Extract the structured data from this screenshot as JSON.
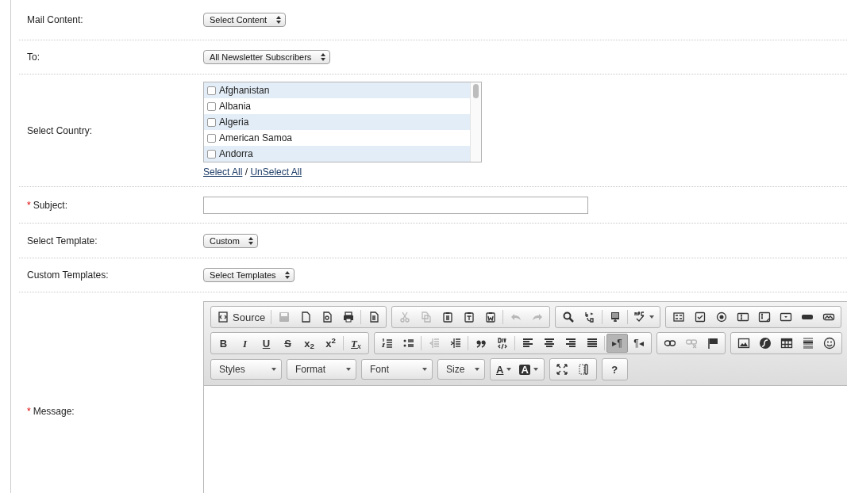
{
  "form": {
    "rows": [
      {
        "kind": "select",
        "label": "Mail Content:",
        "value": "Select Content"
      },
      {
        "kind": "select",
        "label": "To:",
        "value": "All Newsletter Subscribers"
      },
      {
        "kind": "checklist",
        "label": "Select Country:",
        "items": [
          {
            "text": "Afghanistan",
            "checked": false
          },
          {
            "text": "Albania",
            "checked": false
          },
          {
            "text": "Algeria",
            "checked": false
          },
          {
            "text": "American Samoa",
            "checked": false
          },
          {
            "text": "Andorra",
            "checked": false
          }
        ],
        "links": [
          "Select All",
          "UnSelect All"
        ],
        "link_separator": "/"
      },
      {
        "kind": "text",
        "label": "Subject:",
        "mark": "*"
      },
      {
        "kind": "select",
        "label": "Select Template:",
        "value": "Custom"
      },
      {
        "kind": "select",
        "label": "Custom Templates:",
        "value": "Select Templates"
      },
      {
        "kind": "editor",
        "label": "Message:",
        "mark": "*",
        "toolbar": [
          [
            {
              "buttons": [
                {
                  "kind": "text",
                  "label": "Source",
                  "disabled": false,
                  "on": false
                },
                {
                  "kind": "separator"
                },
                {
                  "kind": "icon",
                  "disabled": true,
                  "on": false
                },
                {
                  "kind": "icon",
                  "disabled": false,
                  "on": false
                },
                {
                  "kind": "icon",
                  "disabled": false,
                  "on": false
                },
                {
                  "kind": "icon",
                  "disabled": false,
                  "on": false
                },
                {
                  "kind": "separator"
                },
                {
                  "kind": "icon",
                  "disabled": false,
                  "on": false
                }
              ]
            },
            {
              "buttons": [
                {
                  "kind": "icon",
                  "disabled": true,
                  "on": false
                },
                {
                  "kind": "icon",
                  "disabled": true,
                  "on": false
                },
                {
                  "kind": "icon",
                  "disabled": false,
                  "on": false
                },
                {
                  "kind": "icon",
                  "disabled": false,
                  "on": false
                },
                {
                  "kind": "icon",
                  "disabled": false,
                  "on": false
                },
                {
                  "kind": "separator"
                },
                {
                  "kind": "icon",
                  "disabled": true,
                  "on": false
                },
                {
                  "kind": "icon",
                  "disabled": true,
                  "on": false
                }
              ]
            },
            {
              "buttons": [
                {
                  "kind": "icon",
                  "disabled": false,
                  "on": false
                },
                {
                  "kind": "icon",
                  "disabled": false,
                  "on": false
                },
                {
                  "kind": "separator"
                },
                {
                  "kind": "icon",
                  "disabled": false,
                  "on": false
                },
                {
                  "kind": "separator"
                },
                {
                  "kind": "icon-menu",
                  "disabled": false,
                  "on": false
                }
              ]
            },
            {
              "buttons": [
                {
                  "kind": "icon",
                  "disabled": false,
                  "on": false
                },
                {
                  "kind": "icon",
                  "disabled": false,
                  "on": false
                },
                {
                  "kind": "icon",
                  "disabled": false,
                  "on": false
                },
                {
                  "kind": "icon",
                  "disabled": false,
                  "on": false
                },
                {
                  "kind": "icon",
                  "disabled": false,
                  "on": false
                },
                {
                  "kind": "icon",
                  "disabled": false,
                  "on": false
                },
                {
                  "kind": "icon",
                  "disabled": false,
                  "on": false
                },
                {
                  "kind": "icon",
                  "disabled": false,
                  "on": false
                }
              ]
            }
          ],
          [
            {
              "buttons": [
                {
                  "kind": "bold",
                  "label": "B",
                  "disabled": false,
                  "on": false
                },
                {
                  "kind": "italic",
                  "label": "I",
                  "disabled": false,
                  "on": false
                },
                {
                  "kind": "underline",
                  "label": "U",
                  "disabled": false,
                  "on": false
                },
                {
                  "kind": "strike",
                  "label": "S",
                  "disabled": false,
                  "on": false
                },
                {
                  "kind": "bold",
                  "label": "x$_{2}$",
                  "disabled": false,
                  "on": false
                },
                {
                  "kind": "bold",
                  "label": "x$^{2}$",
                  "disabled": false,
                  "on": false
                },
                {
                  "kind": "separator"
                },
                {
                  "kind": "clearformat",
                  "label": "T$_{x}$",
                  "disabled": false,
                  "on": false
                }
              ]
            },
            {
              "buttons": [
                {
                  "kind": "icon",
                  "disabled": false,
                  "on": false
                },
                {
                  "kind": "icon",
                  "disabled": false,
                  "on": false
                },
                {
                  "kind": "separator"
                },
                {
                  "kind": "icon",
                  "disabled": true,
                  "on": false
                },
                {
                  "kind": "icon",
                  "disabled": false,
                  "on": false
                },
                {
                  "kind": "separator"
                },
                {
                  "kind": "icon",
                  "disabled": false,
                  "on": false
                },
                {
                  "kind": "icon",
                  "disabled": false,
                  "on": false
                },
                {
                  "kind": "separator"
                },
                {
                  "kind": "icon",
                  "disabled": false,
                  "on": false
                },
                {
                  "kind": "icon",
                  "disabled": false,
                  "on": false
                },
                {
                  "kind": "icon",
                  "disabled": false,
                  "on": false
                },
                {
                  "kind": "icon",
                  "disabled": false,
                  "on": false
                },
                {
                  "kind": "separator"
                },
                {
                  "kind": "plain",
                  "label": "▸¶",
                  "disabled": false,
                  "on": true
                },
                {
                  "kind": "plain",
                  "label": "¶◂",
                  "disabled": false,
                  "on": false
                }
              ]
            },
            {
              "buttons": [
                {
                  "kind": "icon",
                  "disabled": false,
                  "on": false
                },
                {
                  "kind": "icon",
                  "disabled": true,
                  "on": false
                },
                {
                  "kind": "icon",
                  "disabled": false,
                  "on": false
                }
              ]
            },
            {
              "buttons": [
                {
                  "kind": "icon",
                  "disabled": false,
                  "on": false
                },
                {
                  "kind": "icon",
                  "disabled": false,
                  "on": false
                },
                {
                  "kind": "icon",
                  "disabled": false,
                  "on": false
                },
                {
                  "kind": "icon",
                  "disabled": false,
                  "on": false
                },
                {
                  "kind": "icon",
                  "disabled": false,
                  "on": false
                }
              ]
            }
          ],
          [
            {
              "buttons": [
                {
                  "kind": "combo",
                  "label": "Styles"
                }
              ]
            },
            {
              "buttons": [
                {
                  "kind": "combo",
                  "label": "Format"
                }
              ]
            },
            {
              "buttons": [
                {
                  "kind": "combo",
                  "label": "Font"
                }
              ]
            },
            {
              "buttons": [
                {
                  "kind": "combo",
                  "label": "Size"
                }
              ]
            },
            {
              "buttons": [
                {
                  "kind": "color",
                  "label": "A",
                  "disabled": false,
                  "on": false
                },
                {
                  "kind": "bgcolor",
                  "label": "A",
                  "disabled": false,
                  "on": false
                }
              ]
            },
            {
              "buttons": [
                {
                  "kind": "icon",
                  "disabled": false,
                  "on": false
                },
                {
                  "kind": "icon",
                  "disabled": false,
                  "on": false
                }
              ]
            },
            {
              "buttons": [
                {
                  "kind": "bold",
                  "label": "?",
                  "disabled": false,
                  "on": false
                }
              ]
            }
          ]
        ]
      }
    ]
  }
}
